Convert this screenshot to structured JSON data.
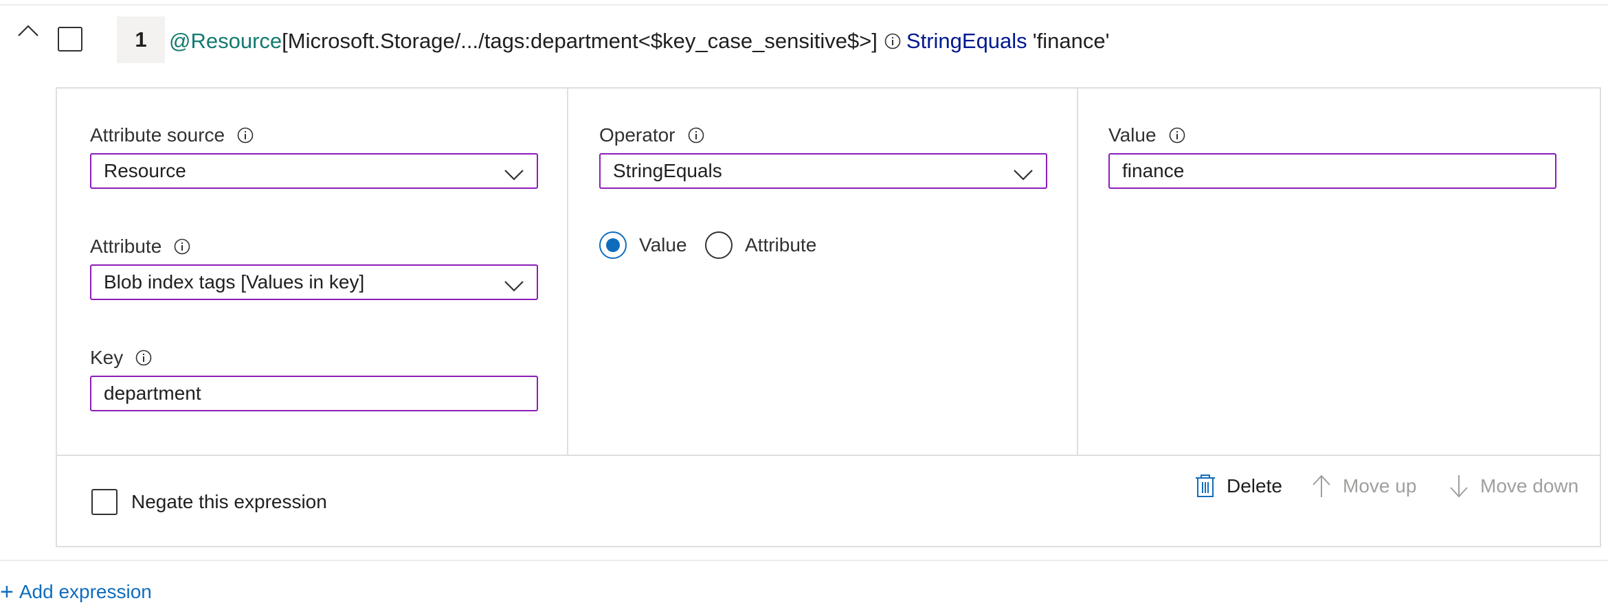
{
  "expression": {
    "number": "1",
    "source": "@Resource",
    "path": "[Microsoft.Storage/.../tags:department<$key_case_sensitive$>]",
    "operator": "StringEquals",
    "value": "'finance'"
  },
  "attribute_source": {
    "label": "Attribute source",
    "value": "Resource"
  },
  "attribute": {
    "label": "Attribute",
    "value": "Blob index tags [Values in key]"
  },
  "key": {
    "label": "Key",
    "value": "department"
  },
  "operator": {
    "label": "Operator",
    "value": "StringEquals",
    "radio_value": "Value",
    "radio_attribute": "Attribute",
    "selected": "Value"
  },
  "value": {
    "label": "Value",
    "value": "finance"
  },
  "negate": {
    "label": "Negate this expression",
    "checked": false
  },
  "actions": {
    "delete": "Delete",
    "move_up": "Move up",
    "move_down": "Move down"
  },
  "add_expression": "Add expression",
  "colors": {
    "accent": "#0f6cbd",
    "field_border": "#8a1db8",
    "source": "#127a6f",
    "operator": "#00188f",
    "disabled": "#a19f9d"
  },
  "icons": [
    "chevron-up-icon",
    "info-icon",
    "chevron-down-icon",
    "trash-icon",
    "arrow-up-icon",
    "arrow-down-icon",
    "plus-icon"
  ]
}
